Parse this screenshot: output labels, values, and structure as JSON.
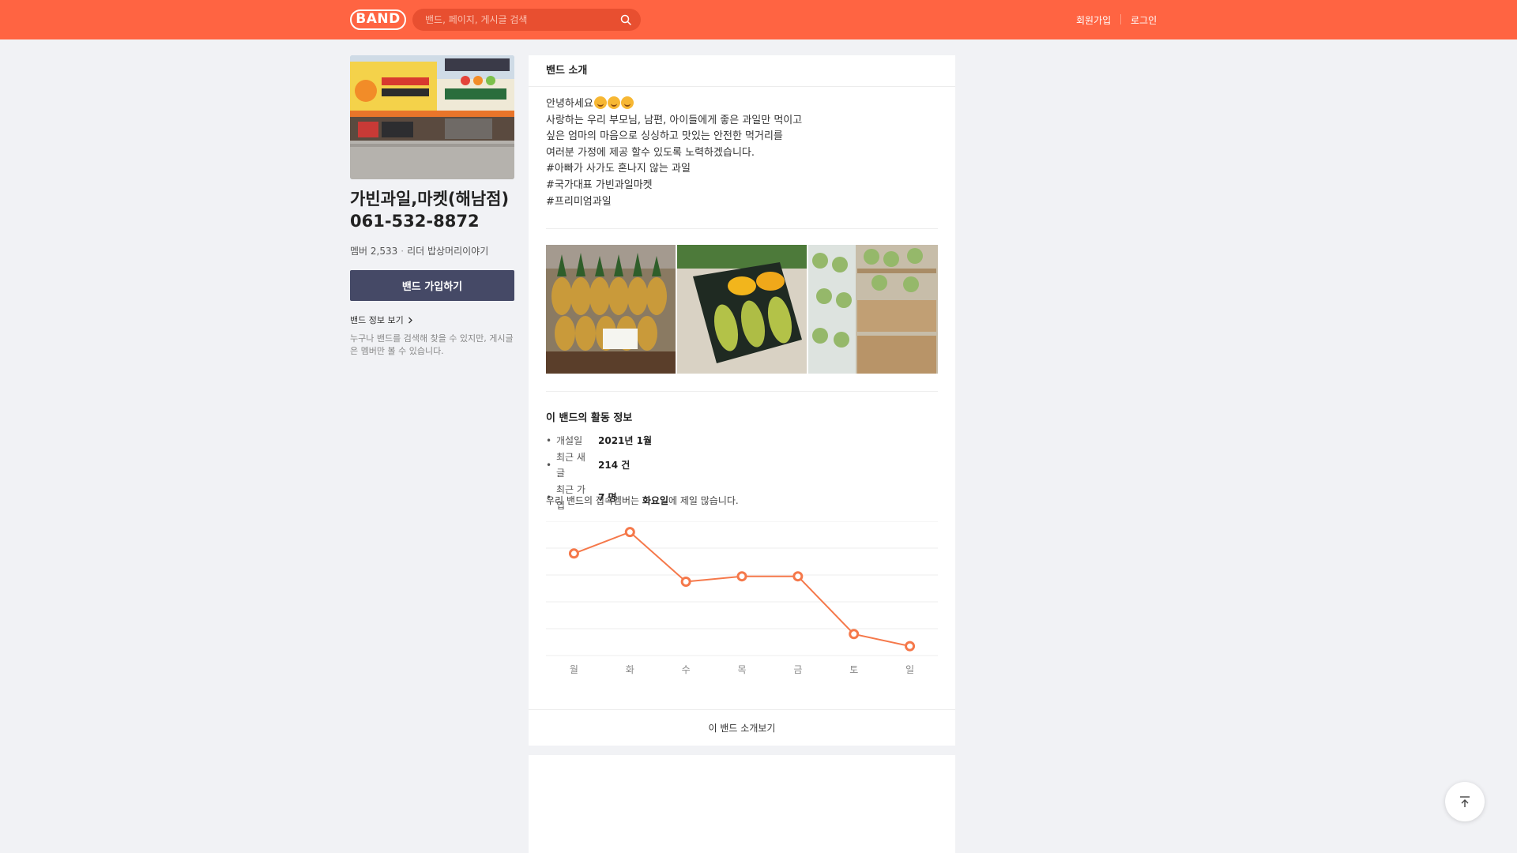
{
  "header": {
    "logo": "BAND",
    "search_placeholder": "밴드, 페이지, 게시글 검색",
    "signup": "회원가입",
    "login": "로그인"
  },
  "band": {
    "name_line1": "가빈과일,마켓(해남점)",
    "name_line2": "061-532-8872",
    "members": "멤버 2,533",
    "leader": "리더 밥상머리이야기",
    "join_button": "밴드 가입하기",
    "info_link": "밴드 정보 보기",
    "info_desc": "누구나 밴드를 검색해 찾을 수 있지만, 게시글은 멤버만 볼 수 있습니다."
  },
  "intro": {
    "heading": "밴드 소개",
    "line1": "안녕하세요",
    "line2": "사랑하는 우리 부모님, 남편, 아이들에게 좋은 과일만 먹이고",
    "line3": "싶은 엄마의 마음으로 싱싱하고 맛있는 안전한 먹거리를",
    "line4": "여러분 가정에 제공 할수 있도록 노력하겠습니다.",
    "line5": "#아빠가 사가도 혼나지 않는 과일",
    "line6": "#국가대표 가빈과일마켓",
    "line7": "#프리미엄과일"
  },
  "activity": {
    "title": "이 밴드의 활동 정보",
    "stats": [
      {
        "label": "개설일",
        "value": "2021년 1월"
      },
      {
        "label": "최근 새글",
        "value": "214 건"
      },
      {
        "label": "최근 가입",
        "value": "7 명"
      }
    ],
    "summary_pre": "우리 밴드의 접속멤버는 ",
    "summary_day": "화요일",
    "summary_post": "에 제일 많습니다."
  },
  "chart_data": {
    "type": "line",
    "categories": [
      "월",
      "화",
      "수",
      "목",
      "금",
      "토",
      "일"
    ],
    "values": [
      76,
      92,
      55,
      59,
      59,
      16,
      7
    ],
    "ylim": [
      0,
      100
    ],
    "grid": true,
    "color": "#f5784a"
  },
  "footer": {
    "more_intro": "이 밴드 소개보기"
  },
  "colors": {
    "brand": "#ff6442",
    "join_button": "#454966"
  }
}
